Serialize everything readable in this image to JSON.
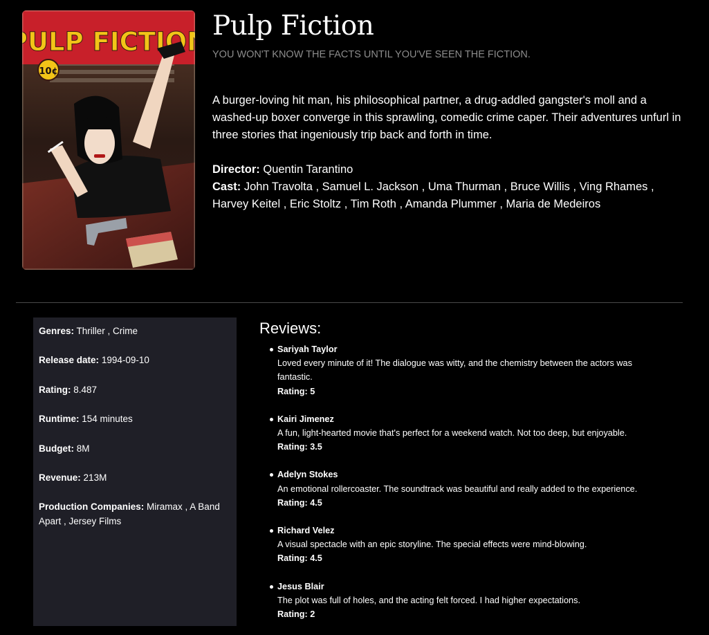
{
  "movie": {
    "title": "Pulp Fiction",
    "tagline": "YOU WON'T KNOW THE FACTS UNTIL YOU'VE SEEN THE FICTION.",
    "overview": "A burger-loving hit man, his philosophical partner, a drug-addled gangster's moll and a washed-up boxer converge in this sprawling, comedic crime caper. Their adventures unfurl in three stories that ingeniously trip back and forth in time.",
    "director_label": "Director:",
    "director": "Quentin Tarantino",
    "cast_label": "Cast:",
    "cast": "John Travolta , Samuel L. Jackson , Uma Thurman , Bruce Willis , Ving Rhames , Harvey Keitel , Eric Stoltz , Tim Roth , Amanda Plummer , Maria de Medeiros",
    "poster": {
      "title_text": "PULP FICTION",
      "price_text": "10¢"
    }
  },
  "details": {
    "genres_label": "Genres:",
    "genres": "Thriller , Crime",
    "release_label": "Release date:",
    "release": "1994-09-10",
    "rating_label": "Rating:",
    "rating": "8.487",
    "runtime_label": "Runtime:",
    "runtime": "154 minutes",
    "budget_label": "Budget:",
    "budget": "8M",
    "revenue_label": "Revenue:",
    "revenue": "213M",
    "companies_label": "Production Companies:",
    "companies": "Miramax , A Band Apart , Jersey Films"
  },
  "reviews": {
    "heading": "Reviews:",
    "items": [
      {
        "author": "Sariyah Taylor",
        "text": "Loved every minute of it! The dialogue was witty, and the chemistry between the actors was fantastic.",
        "rating": "Rating: 5"
      },
      {
        "author": "Kairi Jimenez",
        "text": "A fun, light-hearted movie that's perfect for a weekend watch. Not too deep, but enjoyable.",
        "rating": "Rating: 3.5"
      },
      {
        "author": "Adelyn Stokes",
        "text": "An emotional rollercoaster. The soundtrack was beautiful and really added to the experience.",
        "rating": "Rating: 4.5"
      },
      {
        "author": "Richard Velez",
        "text": "A visual spectacle with an epic storyline. The special effects were mind-blowing.",
        "rating": "Rating: 4.5"
      },
      {
        "author": "Jesus Blair",
        "text": "The plot was full of holes, and the acting felt forced. I had higher expectations.",
        "rating": "Rating: 2"
      }
    ]
  },
  "colors": {
    "background": "#000000",
    "panel": "#1f1f27",
    "tagline": "#8c8c8c",
    "divider": "#4a4a4a",
    "poster_red": "#c8202a",
    "poster_yellow": "#f2c418"
  }
}
